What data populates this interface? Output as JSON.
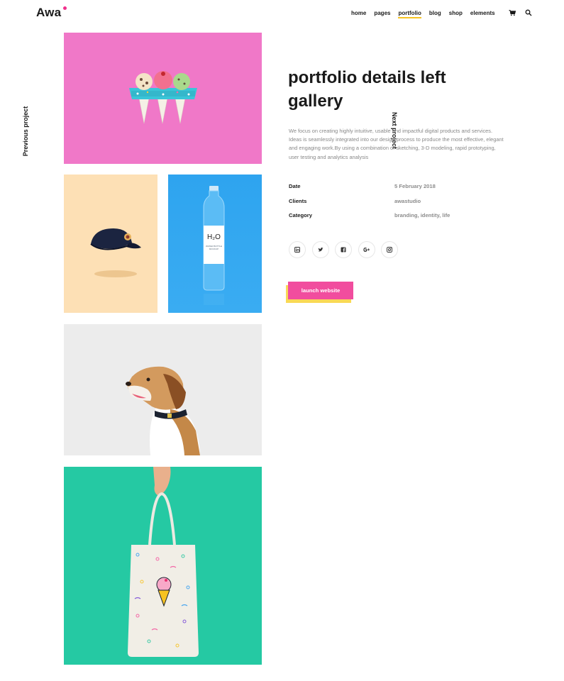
{
  "header": {
    "logo": "Awa",
    "nav": [
      "home",
      "pages",
      "portfolio",
      "blog",
      "shop",
      "elements"
    ],
    "active_nav": "portfolio",
    "icons": [
      "cart-icon",
      "search-icon"
    ]
  },
  "side_nav": {
    "previous": "Previous project",
    "next": "Next project"
  },
  "project": {
    "title": "portfolio details left gallery",
    "description": "We focus on creating highly intuitive, usable and impactful digital products and services. Ideas is seamlessly integrated into our design process to produce the most effective, elegant and engaging work.By using a combination of sketching, 3-D modeling, rapid prototyping, user testing and analytics analysis",
    "meta": [
      {
        "label": "Date",
        "value": "5 February 2018"
      },
      {
        "label": "Clients",
        "value": "awastudio"
      },
      {
        "label": "Category",
        "value": "branding, identity, life"
      }
    ],
    "social": [
      "linkedin-icon",
      "twitter-icon",
      "facebook-icon",
      "google-plus-icon",
      "instagram-icon"
    ],
    "launch_label": "launch website"
  },
  "gallery": {
    "bottle_label": "H₂O",
    "bottle_sub": "WATER BOTTLE MOCKUP"
  },
  "colors": {
    "accent_pink": "#f14d9e",
    "accent_yellow": "#f9d956",
    "tile_pink": "#f078c8",
    "tile_peach": "#fde0b5",
    "tile_blue": "#2ea4ef",
    "tile_green": "#25c9a3"
  }
}
